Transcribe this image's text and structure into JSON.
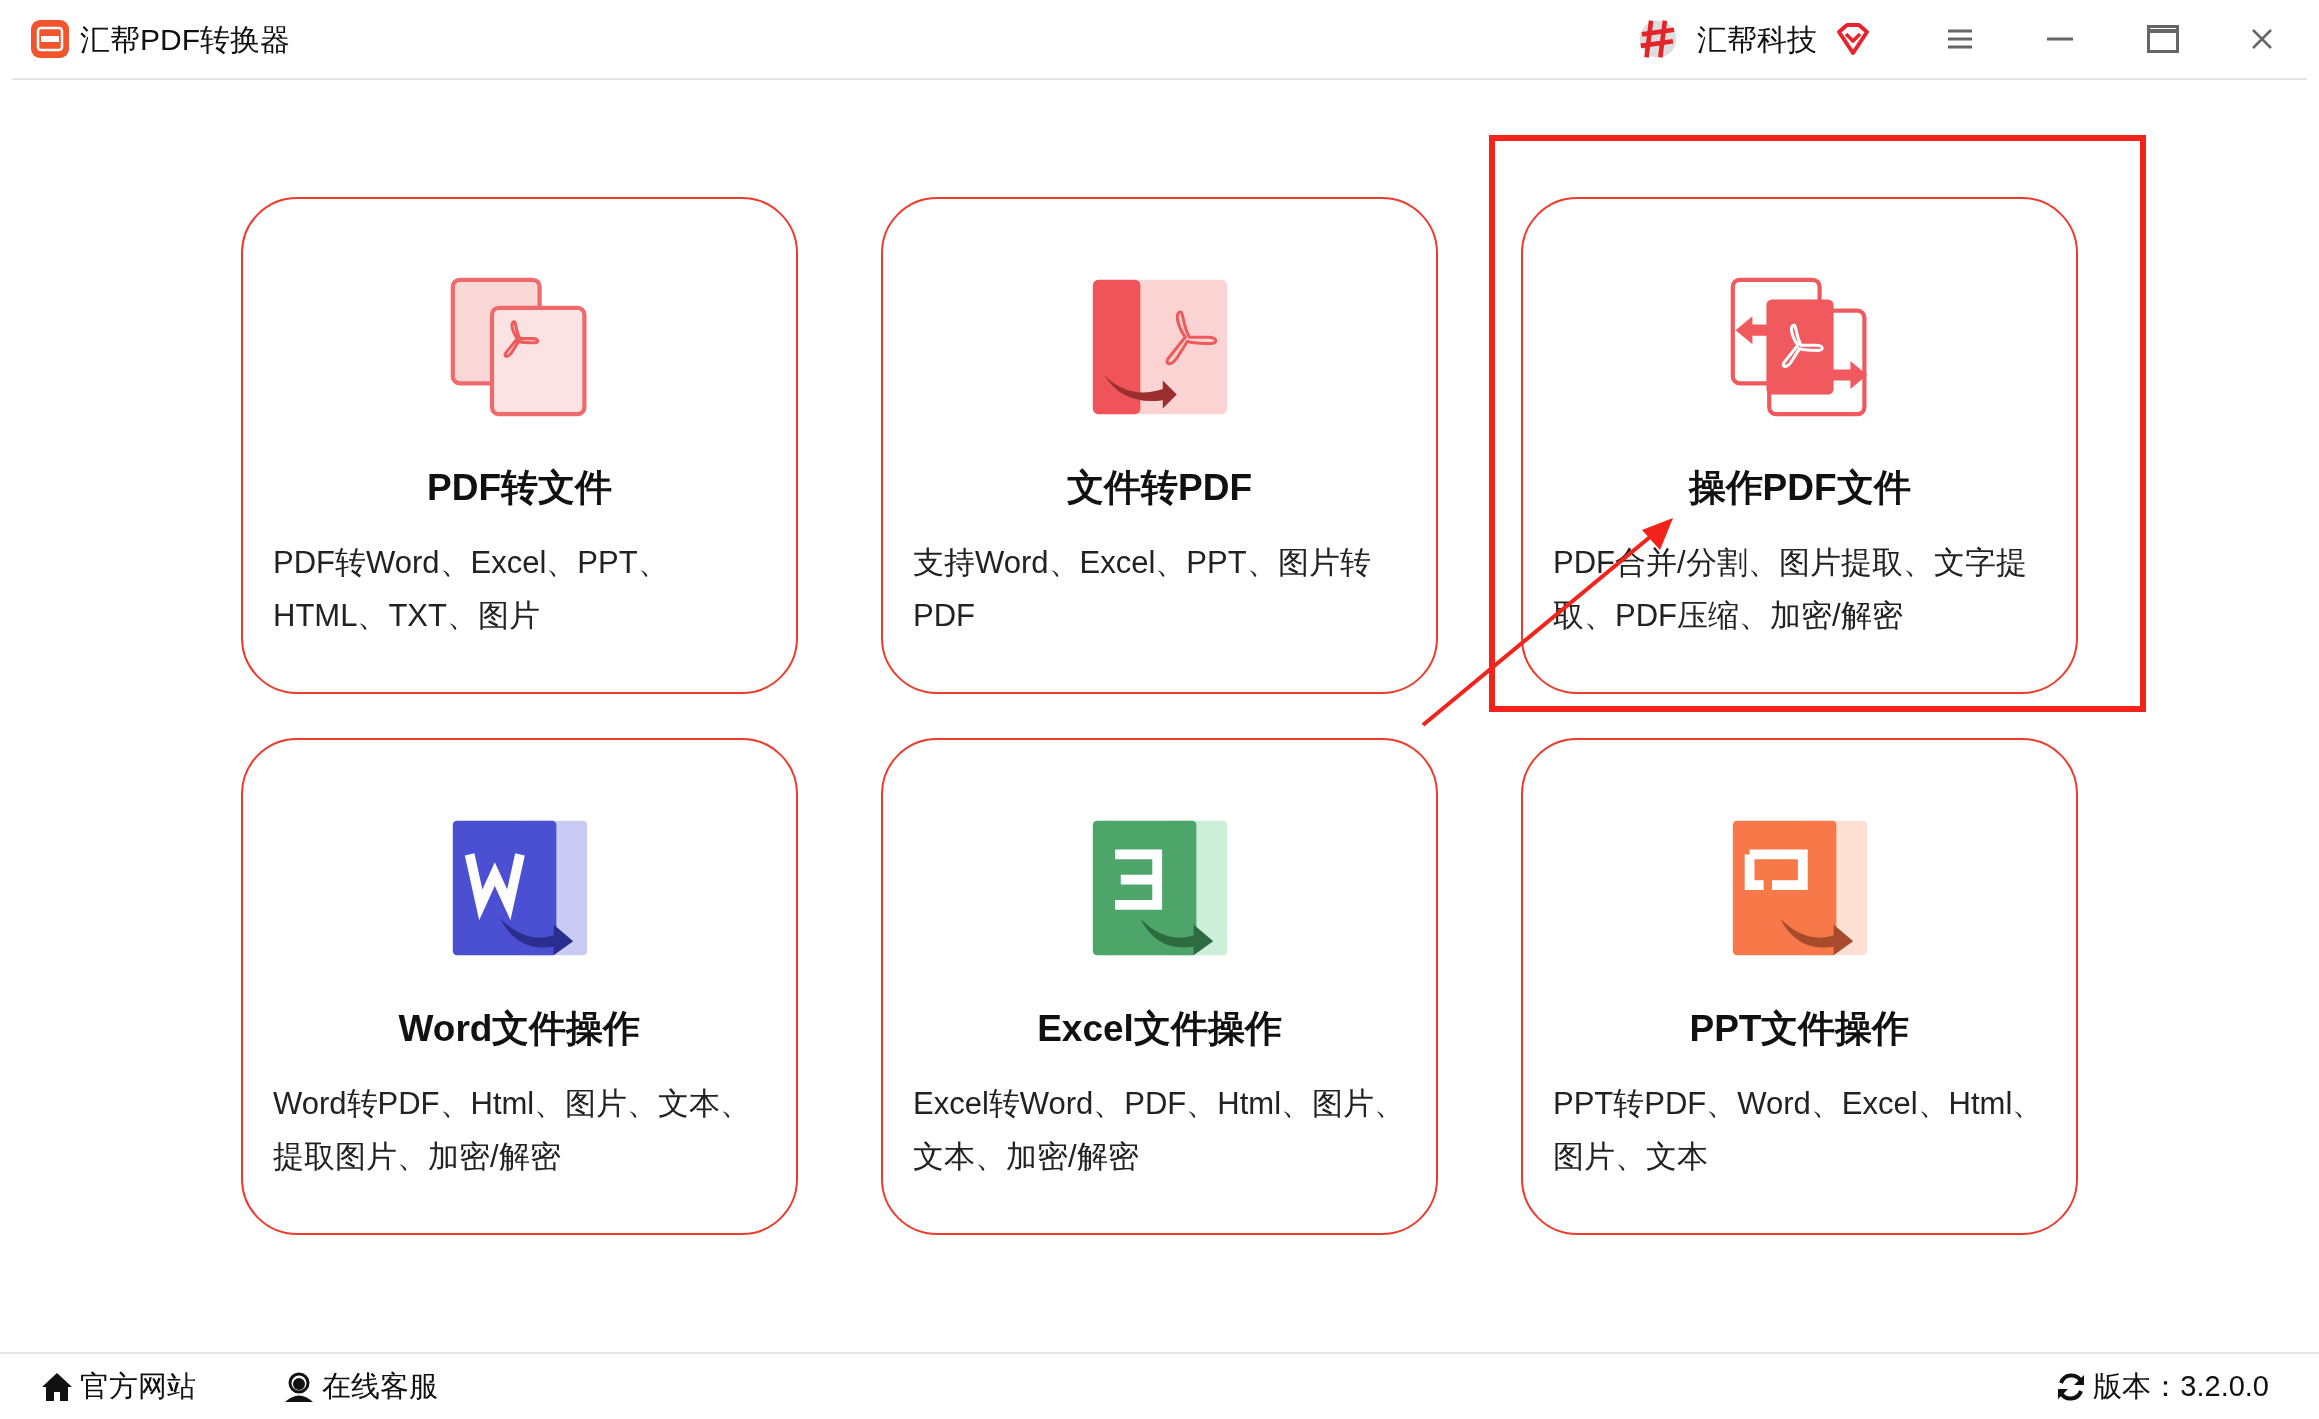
{
  "window": {
    "title": "汇帮PDF转换器",
    "brand": "汇帮科技"
  },
  "cards": [
    {
      "kind": "pdf-to-file",
      "title": "PDF转文件",
      "description": "PDF转Word、Excel、PPT、HTML、TXT、图片",
      "annotated": false
    },
    {
      "kind": "file-to-pdf",
      "title": "文件转PDF",
      "description": "支持Word、Excel、PPT、图片转PDF",
      "annotated": false
    },
    {
      "kind": "pdf-tools",
      "title": "操作PDF文件",
      "description": "PDF合并/分割、图片提取、文字提取、PDF压缩、加密/解密",
      "annotated": true
    },
    {
      "kind": "word",
      "title": "Word文件操作",
      "description": "Word转PDF、Html、图片、文本、提取图片、加密/解密",
      "annotated": false
    },
    {
      "kind": "excel",
      "title": "Excel文件操作",
      "description": "Excel转Word、PDF、Html、图片、文本、加密/解密",
      "annotated": false
    },
    {
      "kind": "ppt",
      "title": "PPT文件操作",
      "description": "PPT转PDF、Word、Excel、Html、图片、文本",
      "annotated": false
    }
  ],
  "status_bar": {
    "links": [
      {
        "kind": "home",
        "label": "官方网站"
      },
      {
        "kind": "support",
        "label": "在线客服"
      }
    ],
    "version": "版本：3.2.0.0"
  }
}
